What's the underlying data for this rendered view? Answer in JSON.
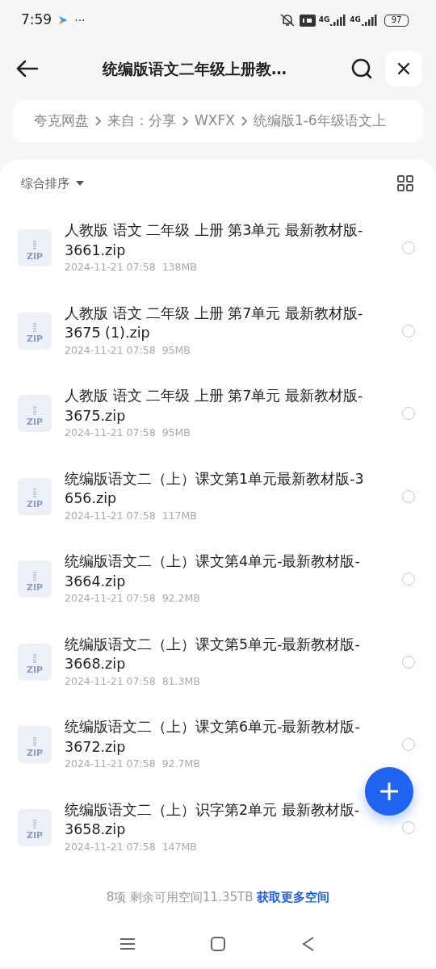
{
  "status_bar": {
    "time": "7:59",
    "dots": "···",
    "network_1": "4G",
    "network_2": "4G",
    "battery": "97"
  },
  "header": {
    "title": "统编版语文二年级上册教…"
  },
  "breadcrumb": [
    {
      "label": "夸克网盘"
    },
    {
      "label": "来自：分享"
    },
    {
      "label": "WXFX"
    },
    {
      "label": "统编版1-6年级语文上"
    }
  ],
  "sort": {
    "label": "综合排序"
  },
  "files": [
    {
      "name": "人教版 语文 二年级 上册 第3单元 最新教材版-3661.zip",
      "type_label": "ZIP",
      "date": "2024-11-21 07:58",
      "size": "138MB",
      "selected": false
    },
    {
      "name": "人教版 语文 二年级 上册 第7单元 最新教材版-3675 (1).zip",
      "type_label": "ZIP",
      "date": "2024-11-21 07:58",
      "size": "95MB",
      "selected": false
    },
    {
      "name": "人教版 语文 二年级 上册 第7单元 最新教材版-3675.zip",
      "type_label": "ZIP",
      "date": "2024-11-21 07:58",
      "size": "95MB",
      "selected": false
    },
    {
      "name": "统编版语文二（上）课文第1单元最新教材版-3656.zip",
      "type_label": "ZIP",
      "date": "2024-11-21 07:58",
      "size": "117MB",
      "selected": false
    },
    {
      "name": "统编版语文二（上）课文第4单元-最新教材版-3664.zip",
      "type_label": "ZIP",
      "date": "2024-11-21 07:58",
      "size": "92.2MB",
      "selected": false
    },
    {
      "name": "统编版语文二（上）课文第5单元-最新教材版-3668.zip",
      "type_label": "ZIP",
      "date": "2024-11-21 07:58",
      "size": "81.3MB",
      "selected": false
    },
    {
      "name": "统编版语文二（上）课文第6单元-最新教材版-3672.zip",
      "type_label": "ZIP",
      "date": "2024-11-21 07:58",
      "size": "92.7MB",
      "selected": false
    },
    {
      "name": "统编版语文二（上）识字第2单元 最新教材版-3658.zip",
      "type_label": "ZIP",
      "date": "2024-11-21 07:58",
      "size": "147MB",
      "selected": false
    }
  ],
  "footer": {
    "summary": "8项 剩余可用空间11.35TB",
    "link": "获取更多空间"
  }
}
